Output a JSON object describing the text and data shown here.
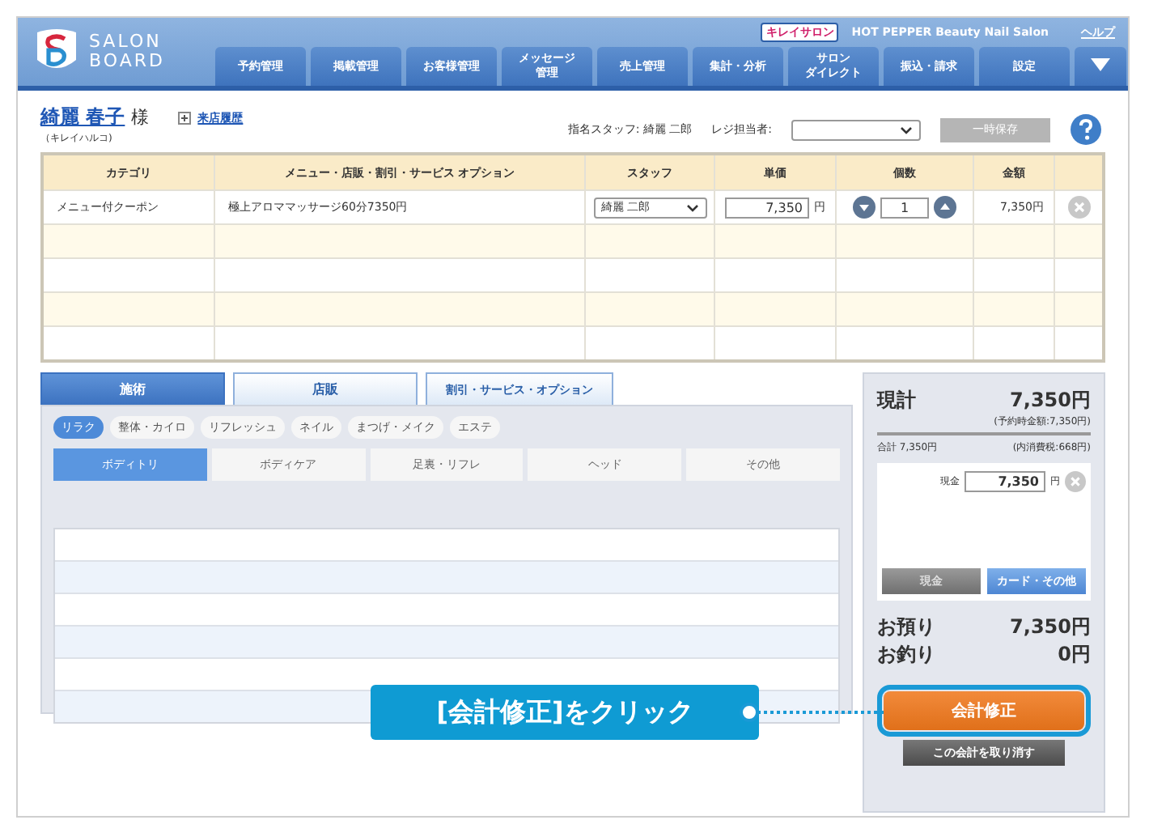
{
  "header": {
    "brand_lines": [
      "SALON",
      "BOARD"
    ],
    "badge": "キレイサロン",
    "salon_name": "HOT PEPPER Beauty Nail Salon",
    "help": "ヘルプ",
    "nav": [
      {
        "lines": [
          "予約管理"
        ]
      },
      {
        "lines": [
          "掲載管理"
        ]
      },
      {
        "lines": [
          "お客様管理"
        ]
      },
      {
        "lines": [
          "メッセージ",
          "管理"
        ]
      },
      {
        "lines": [
          "売上管理"
        ]
      },
      {
        "lines": [
          "集計・分析"
        ]
      },
      {
        "lines": [
          "サロン",
          "ダイレクト"
        ]
      },
      {
        "lines": [
          "振込・請求"
        ]
      },
      {
        "lines": [
          "設定"
        ]
      }
    ]
  },
  "customer": {
    "name": "綺麗 春子",
    "honorific": "様",
    "kana": "（キレイハルコ)",
    "history_link": "来店履歴",
    "staff": "指名スタッフ: 綺麗 二郎",
    "cashier_label": "レジ担当者:",
    "save_button": {
      "label": "一時保存",
      "disabled": true
    }
  },
  "table": {
    "columns": [
      "カテゴリ",
      "メニュー・店販・割引・サービス オプション",
      "スタッフ",
      "単価",
      "個数",
      "金額"
    ],
    "rows": [
      {
        "category": "メニュー付クーポン",
        "menu": "極上アロママッサージ60分7350円",
        "staff": "綺麗 二郎",
        "unit_price": "7,350",
        "unit": "円",
        "quantity": "1",
        "amount": "7,350円"
      }
    ]
  },
  "tabs": [
    {
      "label": "施術",
      "selected": true
    },
    {
      "label": "店販",
      "selected": false
    },
    {
      "label": "割引・サービス・オプション",
      "selected": false
    }
  ],
  "categories": [
    {
      "label": "リラク",
      "selected": true
    },
    {
      "label": "整体・カイロ",
      "selected": false
    },
    {
      "label": "リフレッシュ",
      "selected": false
    },
    {
      "label": "ネイル",
      "selected": false
    },
    {
      "label": "まつげ・メイク",
      "selected": false
    },
    {
      "label": "エステ",
      "selected": false
    }
  ],
  "subtabs": [
    {
      "label": "ボディトリ",
      "selected": true
    },
    {
      "label": "ボディケア",
      "selected": false
    },
    {
      "label": "足裏・リフレ",
      "selected": false
    },
    {
      "label": "ヘッド",
      "selected": false
    },
    {
      "label": "その他",
      "selected": false
    }
  ],
  "summary": {
    "total_label": "現計",
    "total": "7,350円",
    "reserved": "(予約時金額:7,350円)",
    "subtotal": "合計 7,350円",
    "tax": "(内消費税:668円)",
    "cash_label": "現金",
    "cash_value": "7,350",
    "cash_unit": "円",
    "pay_buttons": [
      {
        "label": "現金",
        "selected": false
      },
      {
        "label": "カード・その他",
        "selected": true
      }
    ],
    "deposit_label": "お預り",
    "deposit": "7,350円",
    "change_label": "お釣り",
    "change": "0円",
    "fix_button": "会計修正",
    "cancel_button": "この会計を取り消す"
  },
  "callout": "[会計修正]をクリック"
}
